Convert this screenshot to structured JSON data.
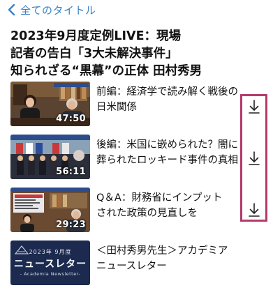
{
  "nav": {
    "back_label": "全てのタイトル"
  },
  "page": {
    "title_lines": [
      "2023年9月度定例LIVE：現場",
      "記者の告白「3大未解決事件」",
      "知られざる“黒幕”の正体 田村秀男"
    ]
  },
  "episodes": [
    {
      "title_lines": [
        "前編：経済学で読み解く戦後の",
        "日米関係"
      ],
      "duration": "47:50",
      "downloadable": true
    },
    {
      "title_lines": [
        "後編：米国に嵌められた？闇に",
        "葬られたロッキード事件の真相"
      ],
      "duration": "56:11",
      "downloadable": true
    },
    {
      "title_lines": [
        "Q＆A：財務省にインプット",
        "された政策の見直しを"
      ],
      "duration": "29:23",
      "downloadable": true
    },
    {
      "title_lines": [
        "＜田村秀男先生＞アカデミア",
        "ニュースレター"
      ],
      "thumbnail": {
        "year_label": "2023年 9月度",
        "main_label": "ニュースレター",
        "sub_label": "- Academia Newsletter-"
      },
      "downloadable": false
    }
  ],
  "colors": {
    "accent": "#3b82c4",
    "highlight": "#b53a6b",
    "newsletter_bg": "#1b2a4e"
  },
  "icons": {
    "back": "chevron-left-icon",
    "download": "download-arrow-icon"
  }
}
